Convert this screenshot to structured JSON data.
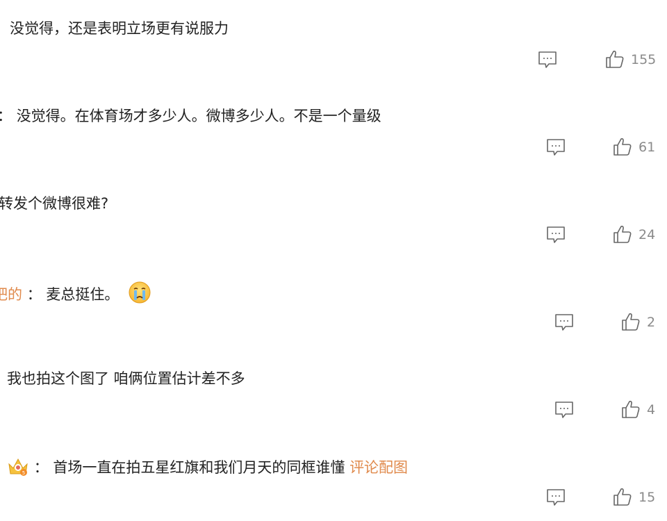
{
  "comments": [
    {
      "prefix": "",
      "text": "没觉得，还是表明立场更有说服力",
      "link": "",
      "likes": "155"
    },
    {
      "prefix": "：",
      "text": "没觉得。在体育场才多少人。微博多少人。不是一个量级",
      "link": "",
      "likes": "61"
    },
    {
      "prefix": "",
      "text": "转发个微博很难?",
      "link": "",
      "likes": "24"
    },
    {
      "user_fragment": "吧的",
      "prefix": "：",
      "text": "麦总挺住。",
      "emoji": "crying-face",
      "link": "",
      "likes": "2"
    },
    {
      "prefix": "",
      "text": "我也拍这个图了 咱俩位置估计差不多",
      "link": "",
      "likes": "4"
    },
    {
      "badge": "crown-avatar",
      "prefix": "：",
      "text": "首场一直在拍五星红旗和我们月天的同框谁懂",
      "link": "评论配图",
      "likes": "15"
    }
  ],
  "colors": {
    "text": "#222222",
    "link": "#e08a4c",
    "meta": "#8a8a8a",
    "icon": "#666666",
    "background": "#ffffff"
  },
  "icons": {
    "reply": "comment-bubble-icon",
    "like": "thumbs-up-icon"
  }
}
